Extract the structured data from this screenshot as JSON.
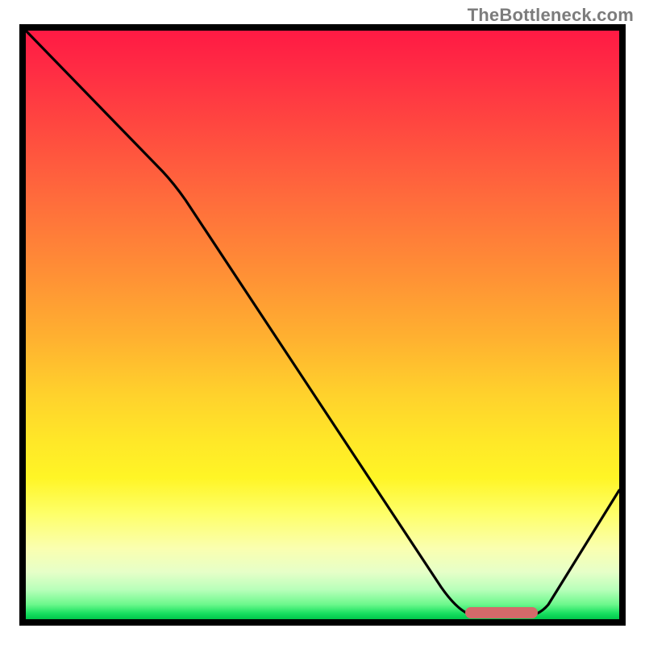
{
  "watermark": "TheBottleneck.com",
  "chart_data": {
    "type": "line",
    "title": "",
    "xlabel": "",
    "ylabel": "",
    "xlim": [
      0,
      100
    ],
    "ylim": [
      0,
      100
    ],
    "grid": false,
    "legend": false,
    "series": [
      {
        "name": "curve",
        "color": "#000000",
        "x": [
          0,
          24,
          26,
          70,
          76,
          84,
          86,
          100
        ],
        "values": [
          100,
          76,
          74,
          6,
          0,
          0,
          2,
          22
        ]
      }
    ],
    "marker": {
      "name": "optimal-range",
      "color": "#d46a6a",
      "x_start": 74,
      "x_end": 86,
      "y": 0.6
    },
    "background": {
      "gradient_stops": [
        {
          "pos": 0,
          "color": "#ff1a44"
        },
        {
          "pos": 50,
          "color": "#ffb030"
        },
        {
          "pos": 78,
          "color": "#feff68"
        },
        {
          "pos": 100,
          "color": "#00c74a"
        }
      ]
    }
  }
}
